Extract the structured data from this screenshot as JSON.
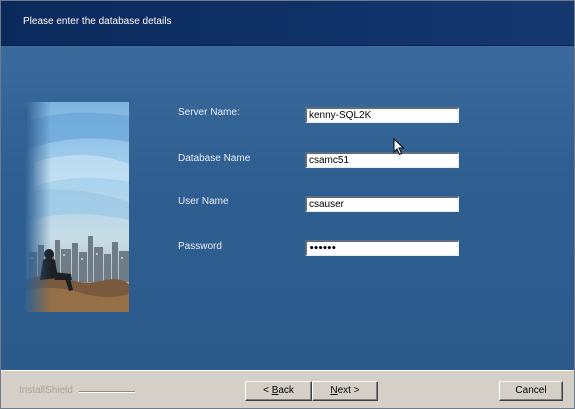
{
  "header": {
    "title": "Please enter the database details"
  },
  "form": {
    "server_name": {
      "label": "Server Name:",
      "value": "kenny-SQL2K"
    },
    "database_name": {
      "label": "Database Name",
      "value": "csamc51"
    },
    "user_name": {
      "label": "User Name",
      "value": "csauser"
    },
    "password": {
      "label": "Password",
      "value": "••••••"
    }
  },
  "footer": {
    "brand": "InstallShield",
    "back_prefix": "< ",
    "back_mnemonic": "B",
    "back_rest": "ack",
    "next_mnemonic": "N",
    "next_rest": "ext >",
    "cancel_label": "Cancel"
  },
  "icons": {
    "side_art": "city-skyline-person-illustration",
    "cursor": "mouse-pointer-icon"
  },
  "colors": {
    "header_bg": "#0f3268",
    "body_bg": "#2f5f91",
    "footer_bg": "#d4d0c8"
  }
}
